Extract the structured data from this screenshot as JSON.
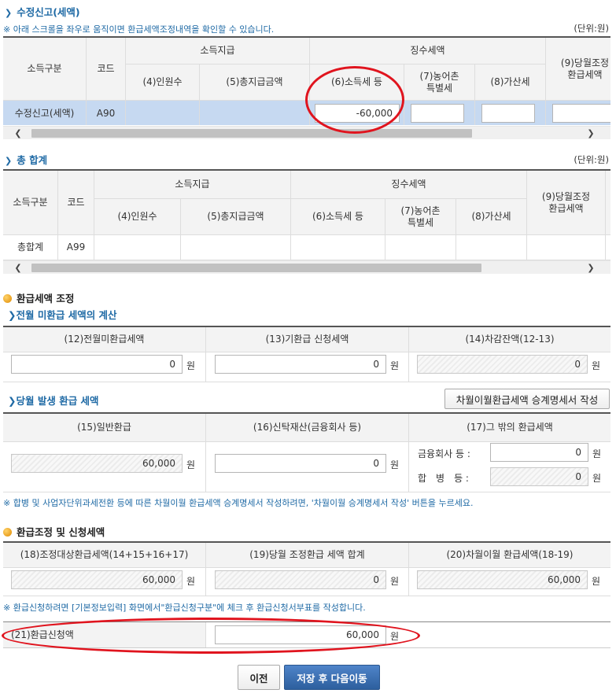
{
  "amend": {
    "title": "수정신고(세액)",
    "note": "※ 아래 스크롤을 좌우로 움직이면 환급세액조정내역을 확인할 수 있습니다.",
    "unit": "(단위:원)",
    "headers": {
      "category": "소득구분",
      "code": "코드",
      "income": "소득지급",
      "tax": "징수세액",
      "h4": "(4)인원수",
      "h5": "(5)총지급금액",
      "h6": "(6)소득세 등",
      "h7a": "(7)농어촌",
      "h7b": "특별세",
      "h8": "(8)가산세",
      "h9a": "(9)당월조정",
      "h9b": "환급세액"
    },
    "row": {
      "category": "수정신고(세액)",
      "code": "A90",
      "income_tax": "-60,000"
    }
  },
  "total": {
    "title": "총 합계",
    "unit": "(단위:원)",
    "headers": {
      "category": "소득구분",
      "code": "코드",
      "income": "소득지급",
      "tax": "징수세액",
      "h4": "(4)인원수",
      "h5": "(5)총지급금액",
      "h6": "(6)소득세 등",
      "h7a": "(7)농어촌",
      "h7b": "특별세",
      "h8": "(8)가산세",
      "h9a": "(9)당월조정",
      "h9b": "환급세액"
    },
    "row": {
      "category": "총합계",
      "code": "A99"
    }
  },
  "refund_adjust": {
    "title": "환급세액 조정",
    "prev": {
      "title": "전월 미환급 세액의 계산",
      "h12": "(12)전월미환급세액",
      "h13": "(13)기환급 신청세액",
      "h14": "(14)차감잔액(12-13)",
      "v12": "0",
      "v13": "0",
      "v14": "0"
    },
    "curr": {
      "title": "당월 발생 환급 세액",
      "carry_button": "차월이월환급세액 승계명세서 작성",
      "h15": "(15)일반환급",
      "h16": "(16)신탁재산(금융회사 등)",
      "h17": "(17)그 밖의 환급세액",
      "v15": "60,000",
      "v16": "0",
      "fin_label": "금융회사 등 :",
      "fin_value": "0",
      "merge_label": "합　병　등 :",
      "merge_value": "0"
    },
    "note": "※ 합병 및 사업자단위과세전환 등에 따른 차월이월 환급세액 승계명세서 작성하려면, '차월이월 승계명세서 작성' 버튼을 누르세요."
  },
  "refund_apply": {
    "title": "환급조정 및 신청세액",
    "h18": "(18)조정대상환급세액(14+15+16+17)",
    "h19": "(19)당월 조정환급 세액 합계",
    "h20": "(20)차월이월 환급세액(18-19)",
    "v18": "60,000",
    "v19": "0",
    "v20": "60,000",
    "note": "※ 환급신청하려면 [기본정보입력] 화면에서\"환급신청구분\"에 체크 후 환급신청서부표를 작성합니다.",
    "h21": "(21)환급신청액",
    "v21": "60,000"
  },
  "won": "원",
  "buttons": {
    "prev": "이전",
    "save_next": "저장 후 다음이동"
  },
  "colors": {
    "accent": "#1f6aa5",
    "selected_row": "#c6d9f1",
    "annotation": "#e0141e"
  }
}
